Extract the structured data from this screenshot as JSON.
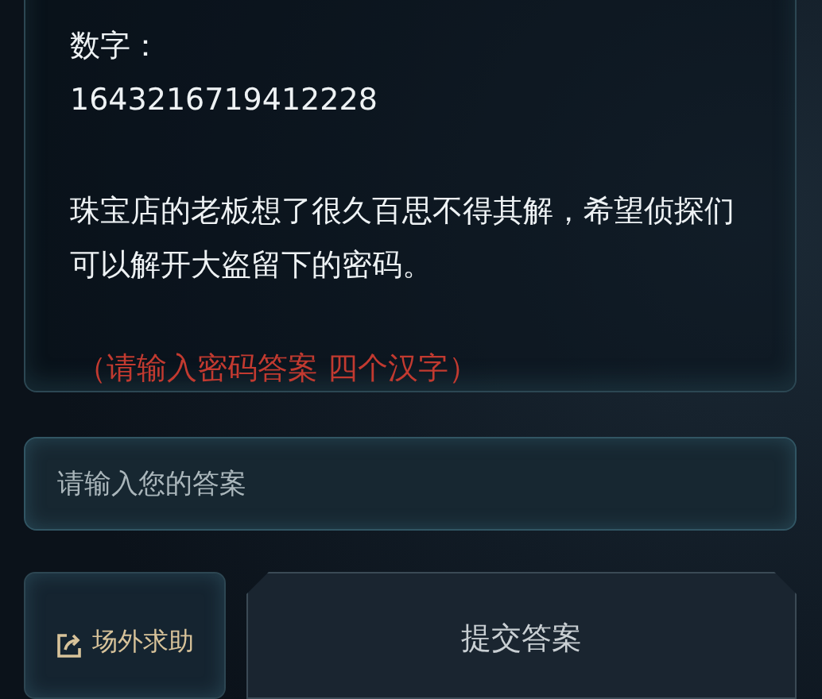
{
  "puzzle_card": {
    "label": "数字：",
    "number": "1643216719412228",
    "story": "珠宝店的老板想了很久百思不得其解，希望侦探们可以解开大盗留下的密码。",
    "hint": "（请输入密码答案 四个汉字）"
  },
  "answer_field": {
    "placeholder": "请输入您的答案"
  },
  "buttons": [
    {
      "kind": "help",
      "label": "场外求助"
    },
    {
      "kind": "submit",
      "label": "提交答案"
    }
  ]
}
